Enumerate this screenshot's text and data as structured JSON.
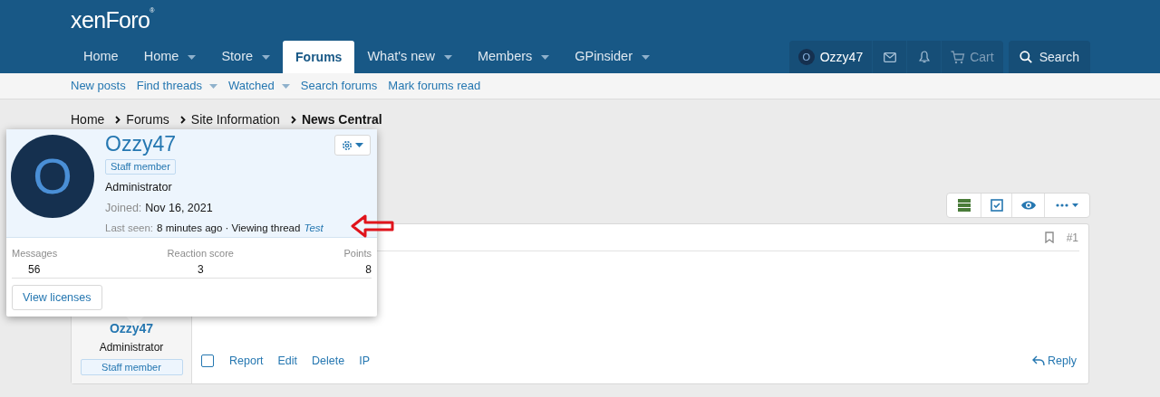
{
  "logo": {
    "text": "xenForo",
    "mark": "®"
  },
  "nav": [
    {
      "label": "Home",
      "dropdown": false,
      "selected": false
    },
    {
      "label": "Home",
      "dropdown": true,
      "selected": false
    },
    {
      "label": "Store",
      "dropdown": true,
      "selected": false
    },
    {
      "label": "Forums",
      "dropdown": false,
      "selected": true
    },
    {
      "label": "What's new",
      "dropdown": true,
      "selected": false
    },
    {
      "label": "Members",
      "dropdown": true,
      "selected": false
    },
    {
      "label": "GPinsider",
      "dropdown": true,
      "selected": false
    }
  ],
  "account": {
    "avatar_letter": "O",
    "username": "Ozzy47",
    "cart": "Cart"
  },
  "search": {
    "label": "Search"
  },
  "subnav": [
    {
      "label": "New posts",
      "dropdown": false
    },
    {
      "label": "Find threads",
      "dropdown": true
    },
    {
      "label": "Watched",
      "dropdown": true
    },
    {
      "label": "Search forums",
      "dropdown": false
    },
    {
      "label": "Mark forums read",
      "dropdown": false
    }
  ],
  "breadcrumb": [
    {
      "label": "Home",
      "current": false
    },
    {
      "label": "Forums",
      "current": false
    },
    {
      "label": "Site Information",
      "current": false
    },
    {
      "label": "News Central",
      "current": true
    }
  ],
  "post": {
    "number": "#1",
    "selected": false,
    "author": {
      "name": "Ozzy47",
      "title": "Administrator",
      "banner": "Staff member"
    },
    "actions": [
      "Report",
      "Edit",
      "Delete",
      "IP"
    ],
    "reply": "Reply"
  },
  "member_tooltip": {
    "avatar_letter": "O",
    "name": "Ozzy47",
    "banner": "Staff member",
    "title": "Administrator",
    "joined_label": "Joined:",
    "joined": "Nov 16, 2021",
    "last_seen_label": "Last seen:",
    "last_seen": "8 minutes ago · Viewing thread",
    "activity_link": "Test",
    "stats": [
      {
        "label": "Messages",
        "value": "56"
      },
      {
        "label": "Reaction score",
        "value": "3"
      },
      {
        "label": "Points",
        "value": "8"
      }
    ],
    "button": "View licenses"
  }
}
